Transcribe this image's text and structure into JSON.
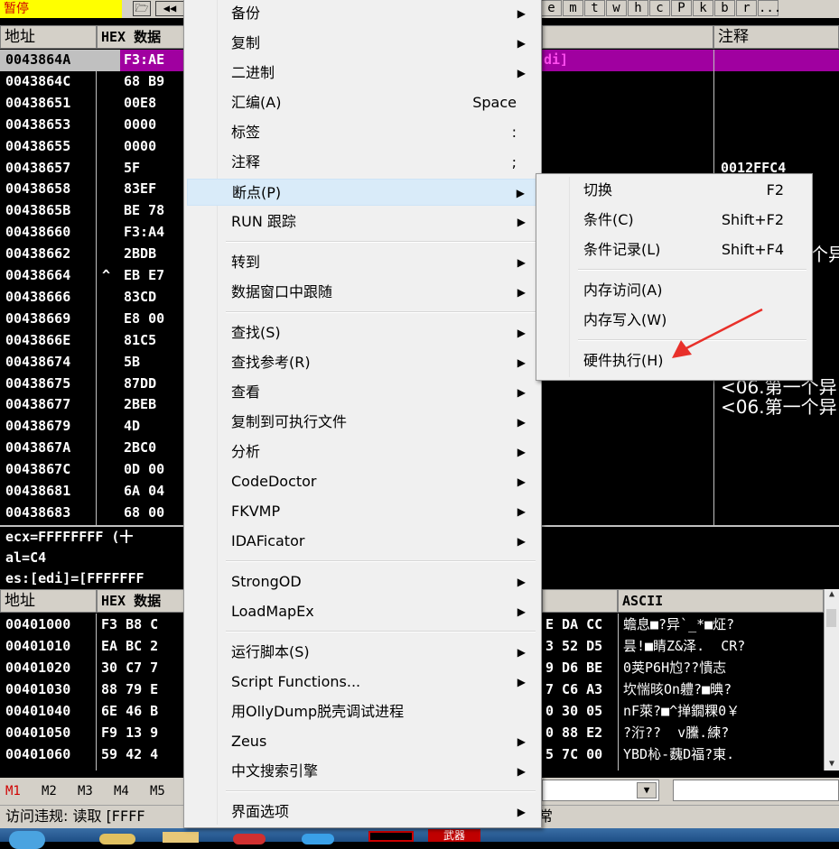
{
  "toolbar": {
    "status": "暂停",
    "letters": [
      "e",
      "m",
      "t",
      "w",
      "h",
      "c",
      "P",
      "k",
      "b",
      "r",
      "..."
    ]
  },
  "cpu": {
    "header_addr": "地址",
    "header_hex": "HEX 数据",
    "header_comment": "注释",
    "rows": [
      {
        "addr": "0043864A",
        "hex": "F3:AE"
      },
      {
        "addr": "0043864C",
        "hex": "68 B9"
      },
      {
        "addr": "00438651",
        "hex": "00E8"
      },
      {
        "addr": "00438653",
        "hex": "0000"
      },
      {
        "addr": "00438655",
        "hex": "0000"
      },
      {
        "addr": "00438657",
        "hex": "5F"
      },
      {
        "addr": "00438658",
        "hex": "83EF"
      },
      {
        "addr": "0043865B",
        "hex": "BE 78"
      },
      {
        "addr": "00438660",
        "hex": "F3:A4"
      },
      {
        "addr": "00438662",
        "hex": "2BDB"
      },
      {
        "addr": "00438664",
        "hex": "EB E7"
      },
      {
        "addr": "00438666",
        "hex": "83CD"
      },
      {
        "addr": "00438669",
        "hex": "E8 00"
      },
      {
        "addr": "0043866E",
        "hex": "81C5"
      },
      {
        "addr": "00438674",
        "hex": "5B"
      },
      {
        "addr": "00438675",
        "hex": "87DD"
      },
      {
        "addr": "00438677",
        "hex": "2BEB"
      },
      {
        "addr": "00438679",
        "hex": "4D"
      },
      {
        "addr": "0043867A",
        "hex": "2BC0"
      },
      {
        "addr": "0043867C",
        "hex": "0D 00"
      },
      {
        "addr": "00438681",
        "hex": "6A 04"
      },
      {
        "addr": "00438683",
        "hex": "68 00"
      }
    ],
    "jump_marker": "^",
    "disasm_highlight": "di]",
    "comments": {
      "c1": "0012FFC4",
      "c2": "个异",
      "c3": "<06.第一个异",
      "c4": "<06.第一个异"
    }
  },
  "info": {
    "line1": "ecx=FFFFFFFF (十",
    "line2": "al=C4",
    "line3": "es:[edi]=[FFFFFFF"
  },
  "dump": {
    "header_addr": "地址",
    "header_hex": "HEX 数据",
    "header_ascii": "ASCII",
    "rows": [
      {
        "addr": "00401000",
        "hex": "F3 B8 C",
        "tail": "E DA CC",
        "ascii": "蟾息■?异`_*■炡?"
      },
      {
        "addr": "00401010",
        "hex": "EA BC 2",
        "tail": "3 52 D5",
        "ascii": "昙!■睛Z&泽.  CR?"
      },
      {
        "addr": "00401020",
        "hex": "30 C7 7",
        "tail": "9 D6 BE",
        "ascii": "0荚P6H尥??憒志"
      },
      {
        "addr": "00401030",
        "hex": "88 79 E",
        "tail": "7 C6 A3",
        "ascii": "坎惴晐On軆?■晪?"
      },
      {
        "addr": "00401040",
        "hex": "6E 46 B",
        "tail": "0 30 05",
        "ascii": "nF萊?■^掸鐗粿0￥"
      },
      {
        "addr": "00401050",
        "hex": "F9 13 9",
        "tail": "0 88 E2",
        "ascii": "?洐??  v黱.練?"
      },
      {
        "addr": "00401060",
        "hex": "59 42 4",
        "tail": "5 7C 00",
        "ascii": "YBD杺-蘶D福?東."
      }
    ]
  },
  "bottom": {
    "markers": [
      "M1",
      "M2",
      "M3",
      "M4",
      "M5"
    ],
    "status": "访问违规: 读取 [FFFF",
    "status_tail": "常"
  },
  "context_menu": {
    "items": [
      {
        "label": "备份",
        "sub": true
      },
      {
        "label": "复制",
        "sub": true
      },
      {
        "label": "二进制",
        "sub": true
      },
      {
        "label": "汇编(A)",
        "shortcut": "Space"
      },
      {
        "label": "标签",
        "shortcut": ":"
      },
      {
        "label": "注释",
        "shortcut": ";"
      },
      {
        "label": "断点(P)",
        "sub": true,
        "highlight": true
      },
      {
        "label": "RUN 跟踪",
        "sub": true
      },
      {
        "label": "转到",
        "sub": true
      },
      {
        "label": "数据窗口中跟随",
        "sub": true
      },
      {
        "label": "查找(S)",
        "sub": true
      },
      {
        "label": "查找参考(R)",
        "sub": true
      },
      {
        "label": "查看",
        "sub": true
      },
      {
        "label": "复制到可执行文件",
        "sub": true
      },
      {
        "label": "分析",
        "sub": true
      },
      {
        "label": "CodeDoctor",
        "sub": true
      },
      {
        "label": "FKVMP",
        "sub": true
      },
      {
        "label": "IDAFicator",
        "sub": true
      },
      {
        "label": "StrongOD",
        "sub": true
      },
      {
        "label": "LoadMapEx",
        "sub": true
      },
      {
        "label": "运行脚本(S)",
        "sub": true
      },
      {
        "label": "Script Functions...",
        "sub": true
      },
      {
        "label": "用OllyDump脱壳调试进程"
      },
      {
        "label": "Zeus",
        "sub": true
      },
      {
        "label": "中文搜索引擎",
        "sub": true
      },
      {
        "label": "界面选项",
        "sub": true
      }
    ]
  },
  "breakpoint_submenu": {
    "items": [
      {
        "label": "切换",
        "shortcut": "F2"
      },
      {
        "label": "条件(C)",
        "shortcut": "Shift+F2"
      },
      {
        "label": "条件记录(L)",
        "shortcut": "Shift+F4"
      },
      {
        "label": "内存访问(A)"
      },
      {
        "label": "内存写入(W)"
      },
      {
        "label": "硬件执行(H)"
      }
    ]
  },
  "taskbar": {
    "button_label": "武器"
  },
  "colors": {
    "highlight_row": "#a000a0",
    "paused_bg": "#ffff00",
    "arrow": "#e8302a"
  },
  "icons": {
    "submenu": "triangle-right-icon",
    "annotation": "red-arrow-icon"
  }
}
